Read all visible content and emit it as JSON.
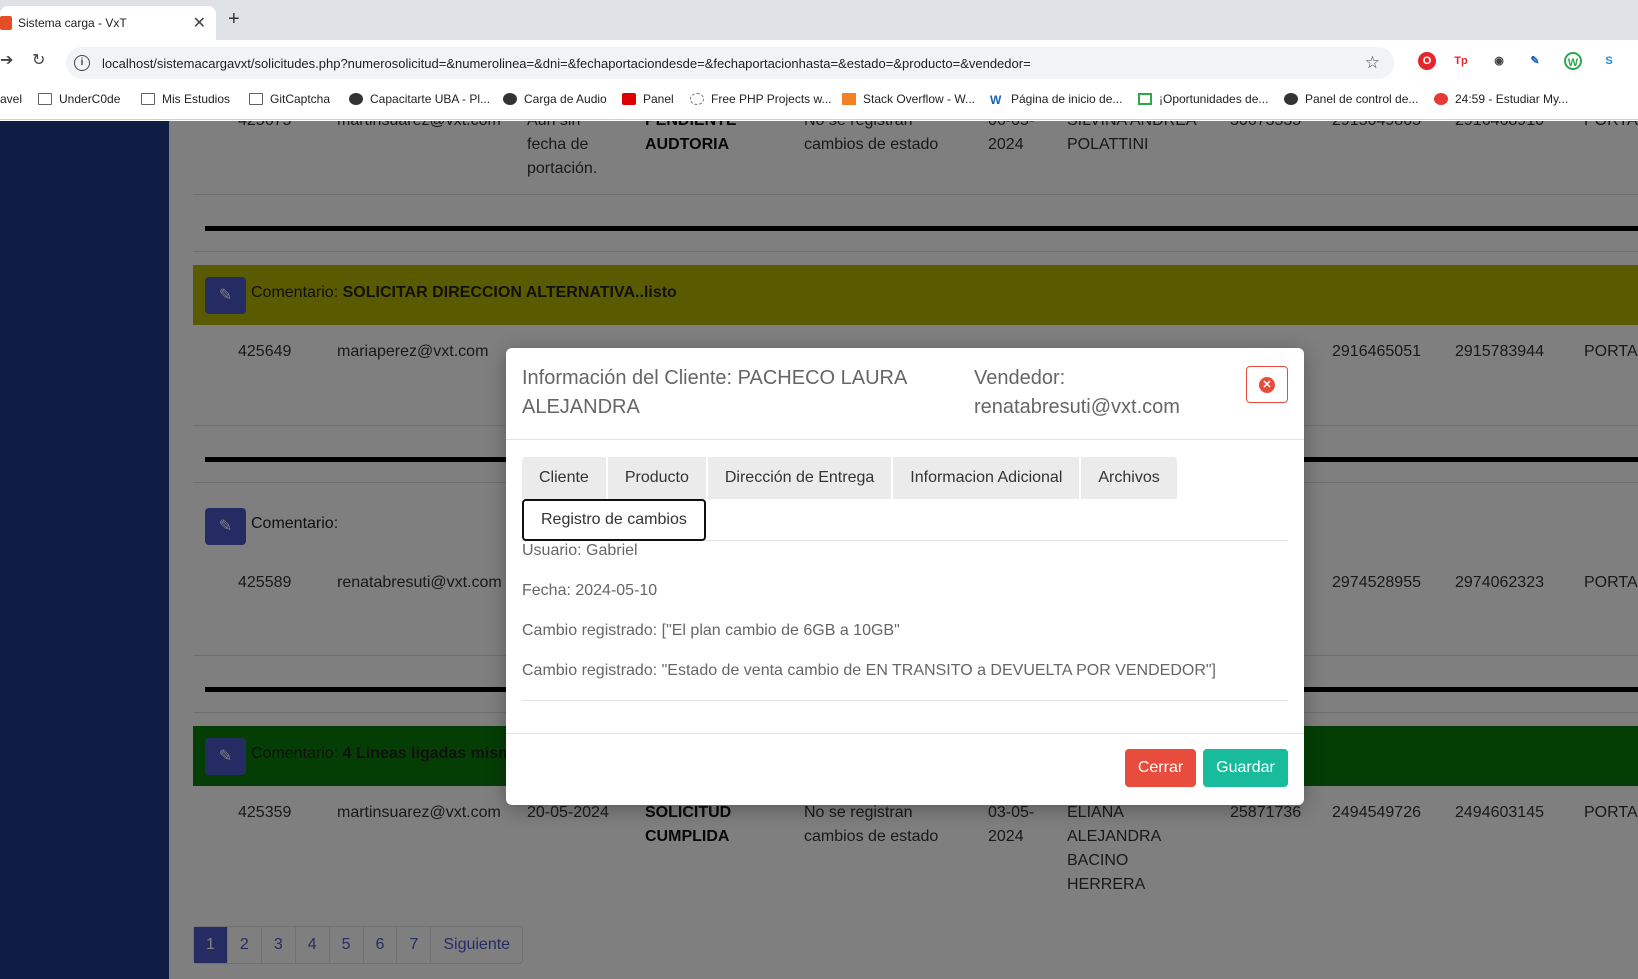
{
  "browser": {
    "tab_title": "Sistema carga - VxT",
    "url": "localhost/sistemacargavxt/solicitudes.php?numerosolicitud=&numerolinea=&dni=&fechaportaciondesde=&fechaportacionhasta=&estado=&producto=&vendedor=",
    "bookmarks": [
      "avel",
      "UnderC0de",
      "Mis Estudios",
      "GitCaptcha",
      "Capacitarte UBA - Pl...",
      "Carga de Audio",
      "Panel",
      "Free PHP Projects w...",
      "Stack Overflow - W...",
      "Página de inicio de...",
      "¡Oportunidades de...",
      "Panel de control de...",
      "24:59 - Estudiar My..."
    ],
    "extensions": [
      "O",
      "Tp",
      "◉",
      "✎",
      "W",
      "S"
    ]
  },
  "table": {
    "row1": {
      "id": "425675",
      "email": "martinsuarez@vxt.com",
      "fecha": [
        "Aún sin",
        "fecha de",
        "portación."
      ],
      "estado": [
        "PENDIENTE",
        "AUDTORIA"
      ],
      "cambios": [
        "No se registran",
        "cambios de estado"
      ],
      "fecha_port": [
        "06-05-",
        "2024"
      ],
      "cliente": [
        "SILVINA ANDREA",
        "POLATTINI"
      ],
      "dni": "30673535",
      "linea": "2915049805",
      "tel": "2916468910",
      "producto": "PORTA"
    },
    "comment2": {
      "label": "Comentario:",
      "text": "SOLICITAR DIRECCION ALTERNATIVA..listo",
      "color": "#b5b400"
    },
    "row2": {
      "id": "425649",
      "email": "mariaperez@vxt.com",
      "linea": "2916465051",
      "tel": "2915783944",
      "producto": "PORTA"
    },
    "comment3": {
      "label": "Comentario:",
      "text": ""
    },
    "row3": {
      "id": "425589",
      "email": "renatabresuti@vxt.com",
      "linea": "2974528955",
      "tel": "2974062323",
      "producto": "PORTA"
    },
    "comment4": {
      "label": "Comentario:",
      "text": "4 Lineas ligadas mism",
      "color": "#0a7d0a"
    },
    "row4": {
      "id": "425359",
      "email": "martinsuarez@vxt.com",
      "fecha": "20-05-2024",
      "estado": [
        "SOLICITUD",
        "CUMPLIDA"
      ],
      "cambios": [
        "No se registran",
        "cambios de estado"
      ],
      "fecha_port": [
        "03-05-",
        "2024"
      ],
      "cliente": [
        "ELIANA",
        "ALEJANDRA",
        "BACINO",
        "HERRERA"
      ],
      "dni": "25871736",
      "linea": "2494549726",
      "tel": "2494603145",
      "producto": "PORTA"
    }
  },
  "pagination": {
    "pages": [
      "1",
      "2",
      "3",
      "4",
      "5",
      "6",
      "7"
    ],
    "next": "Siguiente",
    "active": "1"
  },
  "modal": {
    "title": "Información del Cliente: PACHECO LAURA ALEJANDRA",
    "vendor": "Vendedor: renatabresuti@vxt.com",
    "tabs": [
      "Cliente",
      "Producto",
      "Dirección de Entrega",
      "Informacion Adicional",
      "Archivos"
    ],
    "selected_tab": "Registro de cambios",
    "log": {
      "usuario": "Usuario: Gabriel",
      "fecha": "Fecha: 2024-05-10",
      "cambio1": "Cambio registrado: [\"El plan cambio de 6GB a 10GB\"",
      "cambio2": "Cambio registrado: \"Estado de venta cambio de EN TRANSITO a DEVUELTA POR VENDEDOR\"]"
    },
    "buttons": {
      "close": "Cerrar",
      "save": "Guardar"
    }
  }
}
